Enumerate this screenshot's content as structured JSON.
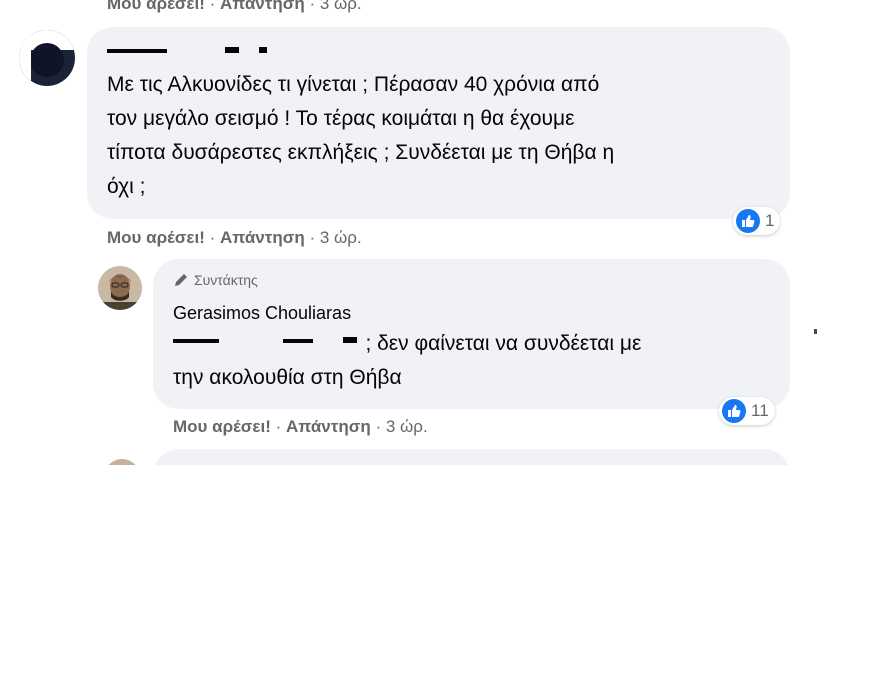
{
  "top_actions": {
    "like": "Μου αρέσει!",
    "reply": "Απάντηση",
    "time": "3 ώρ."
  },
  "comment1": {
    "text": "Με τις Αλκυονίδες τι γίνεται ; Πέρασαν 40 χρόνια από\nτον μεγάλο σεισμό ! Το τέρας κοιμάται η θα έχουμε\nτίποτα δυσάρεστες εκπλήξεις ; Συνδέεται με τη Θήβα η\nόχι ;",
    "reaction_count": "1",
    "actions": {
      "like": "Μου αρέσει!",
      "reply": "Απάντηση",
      "time": "3 ώρ."
    }
  },
  "reply1": {
    "badge": "Συντάκτης",
    "author": "Gerasimos Chouliaras",
    "text": "; δεν φαίνεται να συνδέεται με\nτην ακολουθία στη Θήβα",
    "reaction_count": "11",
    "actions": {
      "like": "Μου αρέσει!",
      "reply": "Απάντηση",
      "time": "3 ώρ."
    }
  },
  "colors": {
    "bubble": "#f0f2f5",
    "meta_text": "#65676b",
    "like_blue": "#1877f2"
  },
  "icons": [
    "like-icon",
    "pencil-icon",
    "avatar"
  ]
}
